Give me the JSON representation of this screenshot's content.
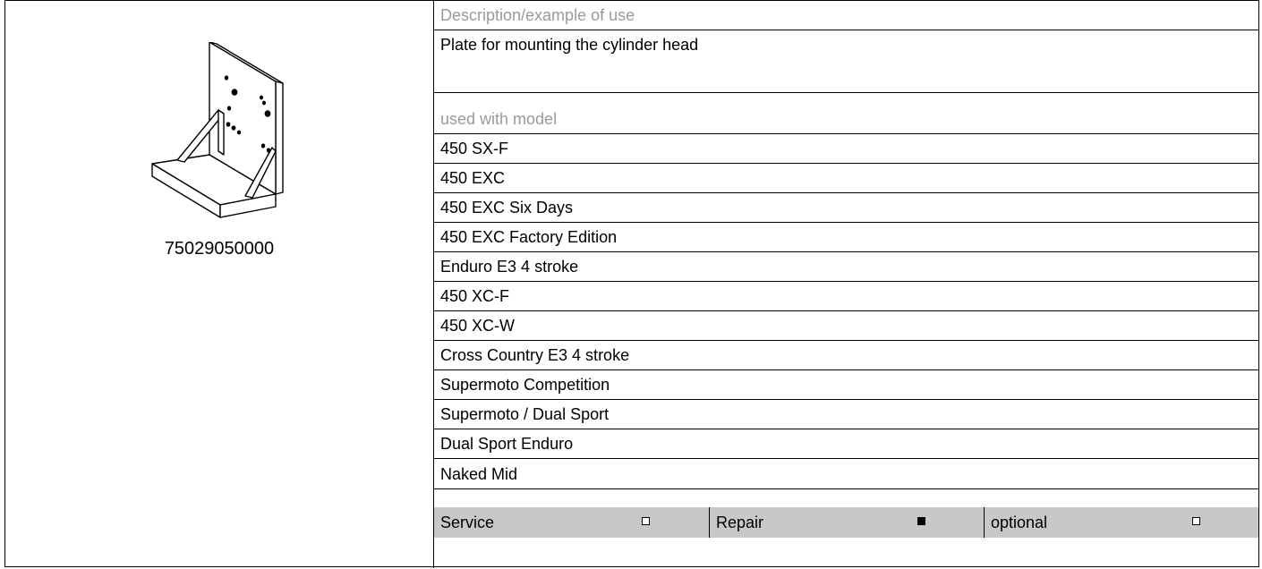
{
  "part": {
    "number": "75029050000"
  },
  "description": {
    "header": "Description/example of use",
    "text": "Plate for mounting the cylinder head"
  },
  "models": {
    "header": "used with model",
    "items": [
      "450 SX-F",
      "450 EXC",
      "450 EXC Six Days",
      "450 EXC Factory Edition",
      "Enduro E3 4 stroke",
      "450 XC-F",
      "450 XC-W",
      "Cross Country E3 4 stroke",
      "Supermoto Competition",
      "Supermoto / Dual Sport",
      "Dual Sport Enduro",
      "Naked Mid"
    ]
  },
  "footer": {
    "cells": [
      {
        "label": "Service",
        "checked": false
      },
      {
        "label": "Repair",
        "checked": true
      },
      {
        "label": "optional",
        "checked": false
      }
    ]
  }
}
